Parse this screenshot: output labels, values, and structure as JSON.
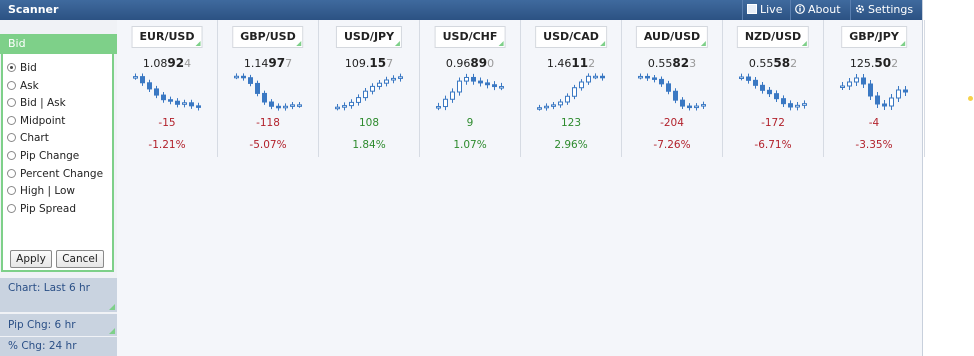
{
  "window": {
    "title": "Scanner",
    "buttons": {
      "live": "Live",
      "about": "About",
      "settings": "Settings"
    }
  },
  "sidebar": {
    "header": "Bid",
    "options": [
      "Bid",
      "Ask",
      "Bid | Ask",
      "Midpoint",
      "Chart",
      "Pip Change",
      "Percent Change",
      "High | Low",
      "Pip Spread"
    ],
    "selected": "Bid",
    "apply": "Apply",
    "cancel": "Cancel",
    "sections": [
      "Chart: Last 6 hr",
      "Pip Chg: 6 hr",
      "% Chg: 24 hr"
    ]
  },
  "colors": {
    "positive": "#2e8b2e",
    "negative": "#b2222c",
    "candle": "#3a78c3",
    "accent": "#7ed089"
  },
  "pairs": [
    {
      "symbol": "EUR/USD",
      "price_main": "1.08",
      "price_big": "92",
      "price_pip": "4",
      "pip_change": "-15",
      "pct_change": "-1.21%",
      "direction": "negative",
      "trend": [
        60,
        56,
        52,
        48,
        45,
        44,
        42,
        43,
        41,
        40
      ]
    },
    {
      "symbol": "GBP/USD",
      "price_main": "1.14",
      "price_big": "97",
      "price_pip": "7",
      "pip_change": "-118",
      "pct_change": "-5.07%",
      "direction": "negative",
      "trend": [
        60,
        59,
        55,
        48,
        42,
        39,
        38,
        39,
        40,
        40
      ]
    },
    {
      "symbol": "USD/JPY",
      "price_main": "109.",
      "price_big": "15",
      "price_pip": "7",
      "pip_change": "108",
      "pct_change": "1.84%",
      "direction": "positive",
      "trend": [
        40,
        41,
        43,
        46,
        50,
        53,
        55,
        57,
        58,
        59
      ]
    },
    {
      "symbol": "USD/CHF",
      "price_main": "0.96",
      "price_big": "89",
      "price_pip": "0",
      "pip_change": "9",
      "pct_change": "1.07%",
      "direction": "positive",
      "trend": [
        42,
        46,
        50,
        56,
        58,
        56,
        55,
        54,
        53,
        53
      ]
    },
    {
      "symbol": "USD/CAD",
      "price_main": "1.46",
      "price_big": "11",
      "price_pip": "2",
      "pip_change": "123",
      "pct_change": "2.96%",
      "direction": "positive",
      "trend": [
        38,
        39,
        40,
        42,
        46,
        52,
        56,
        60,
        60,
        59
      ]
    },
    {
      "symbol": "AUD/USD",
      "price_main": "0.55",
      "price_big": "82",
      "price_pip": "3",
      "pip_change": "-204",
      "pct_change": "-7.26%",
      "direction": "negative",
      "trend": [
        60,
        59,
        58,
        55,
        50,
        44,
        40,
        39,
        40,
        41
      ]
    },
    {
      "symbol": "NZD/USD",
      "price_main": "0.55",
      "price_big": "58",
      "price_pip": "2",
      "pip_change": "-172",
      "pct_change": "-6.71%",
      "direction": "negative",
      "trend": [
        60,
        58,
        55,
        52,
        50,
        47,
        44,
        42,
        43,
        44
      ]
    },
    {
      "symbol": "GBP/JPY",
      "price_main": "125.",
      "price_big": "50",
      "price_pip": "2",
      "pip_change": "-4",
      "pct_change": "-3.35%",
      "direction": "negative",
      "trend": [
        55,
        57,
        59,
        56,
        50,
        46,
        45,
        49,
        53,
        52
      ]
    }
  ]
}
